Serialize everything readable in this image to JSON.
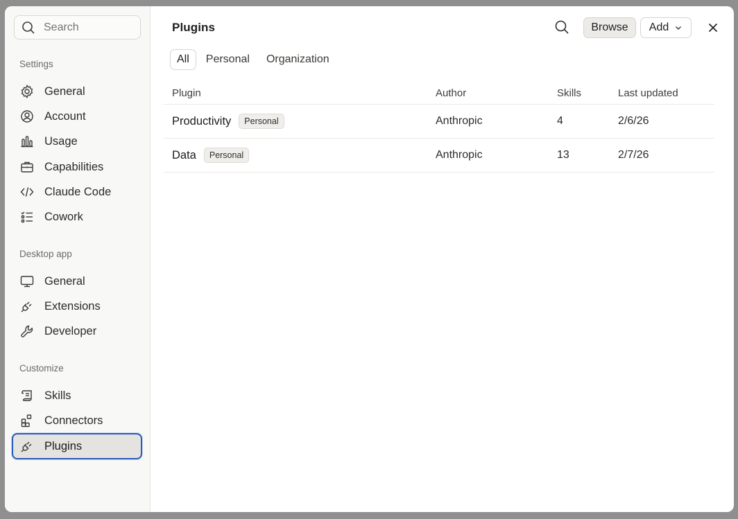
{
  "sidebar": {
    "search_placeholder": "Search",
    "sections": {
      "settings": "Settings",
      "desktop": "Desktop app",
      "customize": "Customize"
    },
    "items": {
      "general": "General",
      "account": "Account",
      "usage": "Usage",
      "capabilities": "Capabilities",
      "claude_code": "Claude Code",
      "cowork": "Cowork",
      "desktop_general": "General",
      "extensions": "Extensions",
      "developer": "Developer",
      "skills": "Skills",
      "connectors": "Connectors",
      "plugins": "Plugins"
    },
    "active_item": "plugins"
  },
  "header": {
    "title": "Plugins",
    "browse_label": "Browse",
    "add_label": "Add"
  },
  "tabs": [
    "All",
    "Personal",
    "Organization"
  ],
  "active_tab": "All",
  "table": {
    "columns": [
      "Plugin",
      "Author",
      "Skills",
      "Last updated"
    ],
    "rows": [
      {
        "name": "Productivity",
        "badge": "Personal",
        "author": "Anthropic",
        "skills": "4",
        "updated": "2/6/26"
      },
      {
        "name": "Data",
        "badge": "Personal",
        "author": "Anthropic",
        "skills": "13",
        "updated": "2/7/26"
      }
    ]
  },
  "colors": {
    "focus_ring": "#2b5bb8",
    "sidebar_bg": "#f8f8f6",
    "backdrop": "#8f8f8f"
  },
  "icons": {
    "general": "gear-icon",
    "account": "user-circle-icon",
    "usage": "bar-chart-icon",
    "capabilities": "briefcase-icon",
    "claude_code": "code-icon",
    "cowork": "checklist-icon",
    "desktop_general": "monitor-icon",
    "extensions": "plug-icon",
    "developer": "wrench-icon",
    "skills": "scroll-icon",
    "connectors": "grid-plus-icon",
    "plugins": "plug-icon"
  }
}
